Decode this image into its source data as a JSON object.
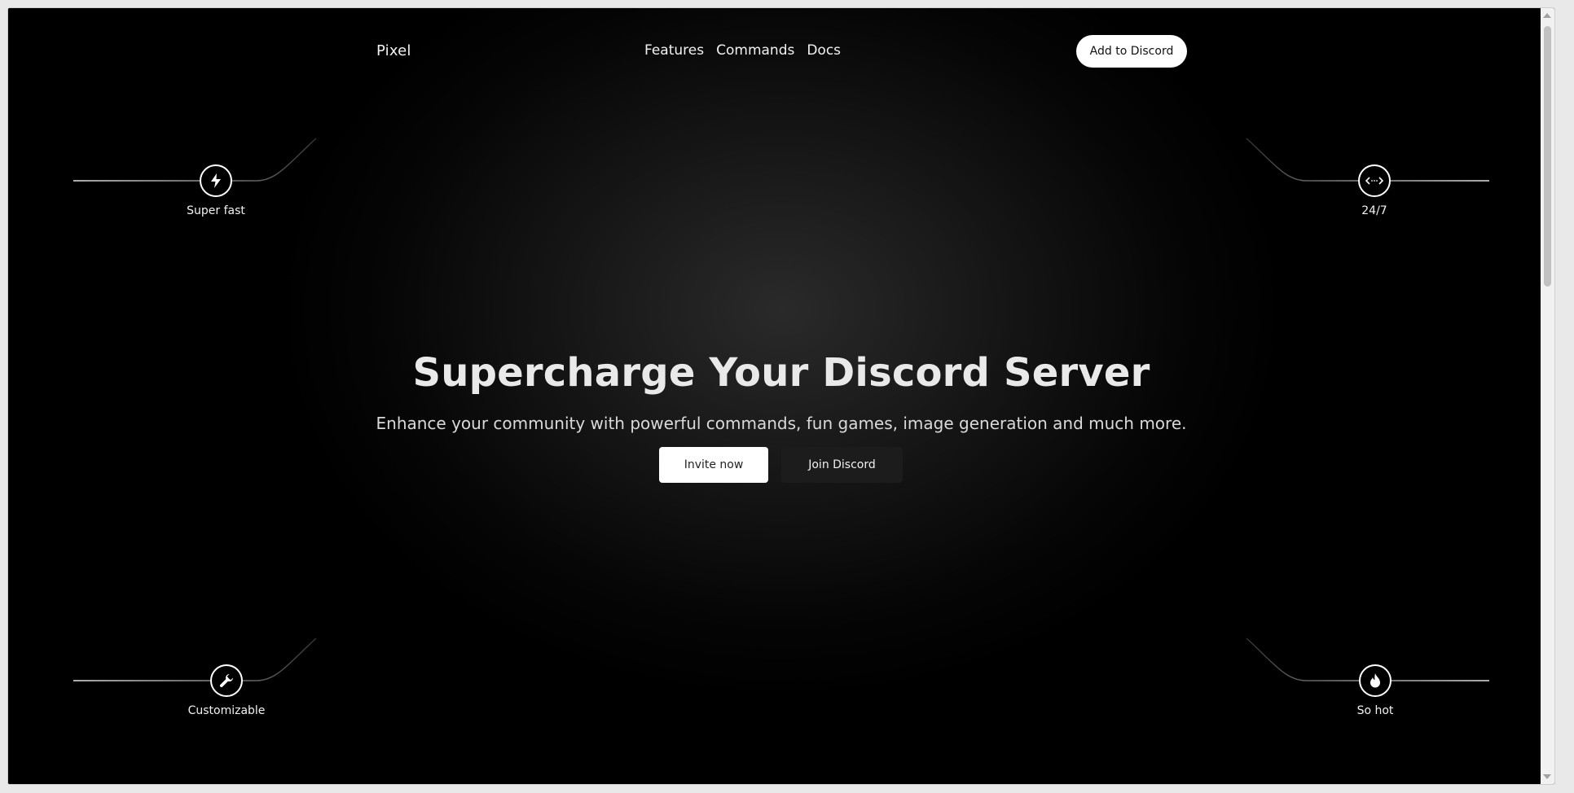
{
  "nav": {
    "brand": "Pixel",
    "links": [
      "Features",
      "Commands",
      "Docs"
    ],
    "cta": "Add to Discord"
  },
  "hero": {
    "title": "Supercharge Your Discord Server",
    "subtitle": "Enhance your community with powerful commands, fun games, image generation and much more.",
    "primary_button": "Invite now",
    "secondary_button": "Join Discord"
  },
  "features": [
    {
      "label": "Super fast",
      "icon": "lightning-icon"
    },
    {
      "label": "24/7",
      "icon": "code-arrows-icon"
    },
    {
      "label": "Customizable",
      "icon": "wrench-icon"
    },
    {
      "label": "So hot",
      "icon": "flame-icon"
    }
  ],
  "colors": {
    "background": "#000000",
    "text": "#f2f2f2",
    "button_light": "#ffffff",
    "button_dark": "#1c1c1c"
  }
}
